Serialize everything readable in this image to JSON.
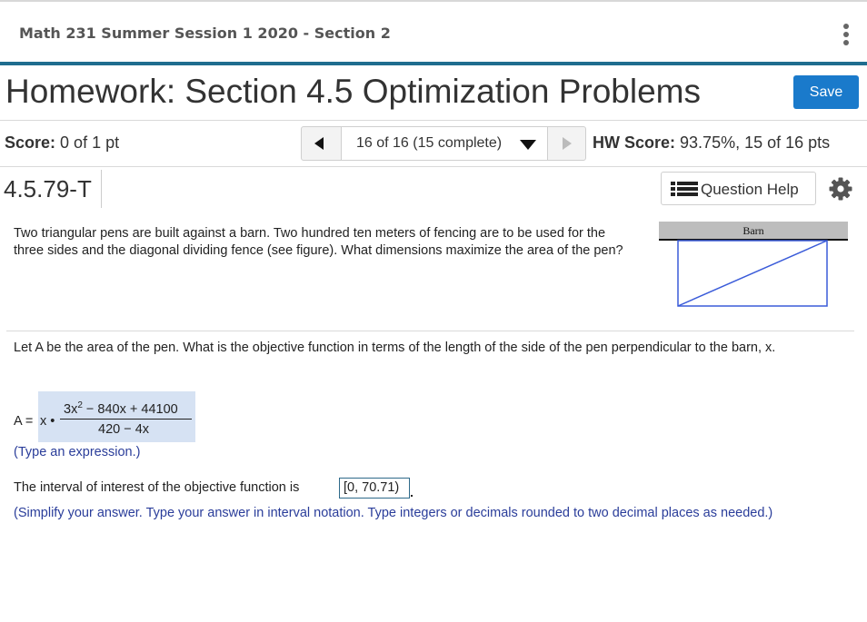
{
  "course": {
    "title": "Math 231 Summer Session 1 2020 - Section 2"
  },
  "header": {
    "title": "Homework: Section 4.5 Optimization Problems",
    "save_label": "Save"
  },
  "status": {
    "score_label": "Score:",
    "score_value": "0 of 1 pt",
    "nav_label": "16 of 16 (15 complete)",
    "hw_score_label": "HW Score:",
    "hw_score_value": "93.75%, 15 of 16 pts"
  },
  "question": {
    "id": "4.5.79-T",
    "help_label": "Question Help"
  },
  "problem": {
    "text": "Two triangular pens are built against a barn. Two hundred ten meters of fencing are to be used for the three sides and the diagonal dividing fence (see figure). What dimensions maximize the area of the pen?",
    "figure_label": "Barn"
  },
  "part1": {
    "prompt": "Let A be the area of the pen. What is the objective function in terms of the length of the side of the pen perpendicular to the barn, x.",
    "answer_lhs": "A =",
    "answer_x": "x •",
    "numerator_lead": "3x",
    "numerator_exp": "2",
    "numerator_rest": " − 840x + 44100",
    "denominator": "420 − 4x",
    "hint": "(Type an expression.)"
  },
  "part2": {
    "prompt": "The interval of interest of the objective function is",
    "answer": "[0, 70.71)",
    "hint": "(Simplify your answer. Type your answer in interval notation. Type integers or decimals rounded to two decimal places as needed.)"
  },
  "colors": {
    "accent": "#1f6d8f",
    "save_button": "#1a7acb",
    "hint_text": "#2a3d9a",
    "answer_fill": "#d6e2f3",
    "figure_rect": "#3a5bd9"
  },
  "icons": {
    "menu": "kebab-icon",
    "prev": "triangle-left-icon",
    "next": "triangle-right-icon",
    "dropdown": "caret-down-icon",
    "help": "list-icon",
    "settings": "gear-icon"
  }
}
